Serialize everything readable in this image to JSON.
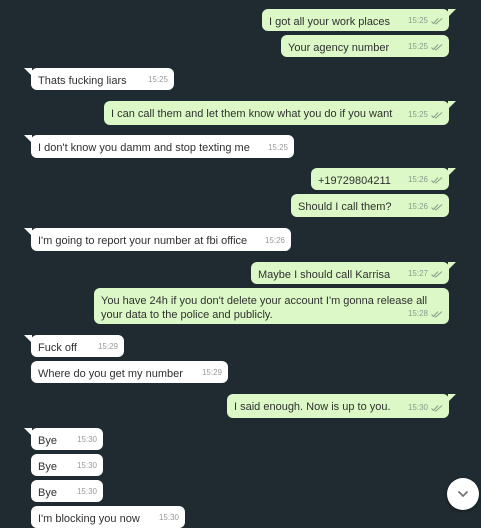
{
  "messages": [
    {
      "dir": "out",
      "text": "I got all your work places",
      "time": "15:25",
      "tail": true,
      "ticks": true
    },
    {
      "dir": "out",
      "text": "Your agency number",
      "time": "15:25",
      "tail": false,
      "ticks": true
    },
    {
      "dir": "in",
      "text": "Thats fucking liars",
      "time": "15:25",
      "tail": true,
      "ticks": false
    },
    {
      "dir": "out",
      "text": "I can call them and let them know what you do if you want",
      "time": "15:25",
      "tail": true,
      "ticks": true
    },
    {
      "dir": "in",
      "text": "I don't know you damm and stop texting me",
      "time": "15:25",
      "tail": true,
      "ticks": false
    },
    {
      "dir": "out",
      "text": "+19729804211",
      "time": "15:26",
      "tail": true,
      "ticks": true
    },
    {
      "dir": "out",
      "text": "Should I call them?",
      "time": "15:26",
      "tail": false,
      "ticks": true
    },
    {
      "dir": "in",
      "text": "I'm going to report your number at fbi office",
      "time": "15:26",
      "tail": true,
      "ticks": false
    },
    {
      "dir": "out",
      "text": "Maybe I should call Karrisa",
      "time": "15:27",
      "tail": true,
      "ticks": true
    },
    {
      "dir": "out",
      "text": "You have 24h if you don't delete your account I'm gonna release all your data to the police and publicly.",
      "time": "15:28",
      "tail": false,
      "ticks": true
    },
    {
      "dir": "in",
      "text": "Fuck off",
      "time": "15:29",
      "tail": true,
      "ticks": false
    },
    {
      "dir": "in",
      "text": "Where do you get my number",
      "time": "15:29",
      "tail": false,
      "ticks": false
    },
    {
      "dir": "out",
      "text": "I said enough. Now is up to you.",
      "time": "15:30",
      "tail": true,
      "ticks": true
    },
    {
      "dir": "in",
      "text": "Bye",
      "time": "15:30",
      "tail": true,
      "ticks": false
    },
    {
      "dir": "in",
      "text": "Bye",
      "time": "15:30",
      "tail": false,
      "ticks": false
    },
    {
      "dir": "in",
      "text": "Bye",
      "time": "15:30",
      "tail": false,
      "ticks": false
    },
    {
      "dir": "in",
      "text": "I'm blocking you now",
      "time": "15:30",
      "tail": false,
      "ticks": false
    }
  ],
  "scroll_button": {
    "icon": "chevron-down-icon"
  },
  "colors": {
    "background": "#1f2b30",
    "outgoing": "#dcf8c6",
    "incoming": "#ffffff",
    "ticks": "#8a9a8e"
  }
}
